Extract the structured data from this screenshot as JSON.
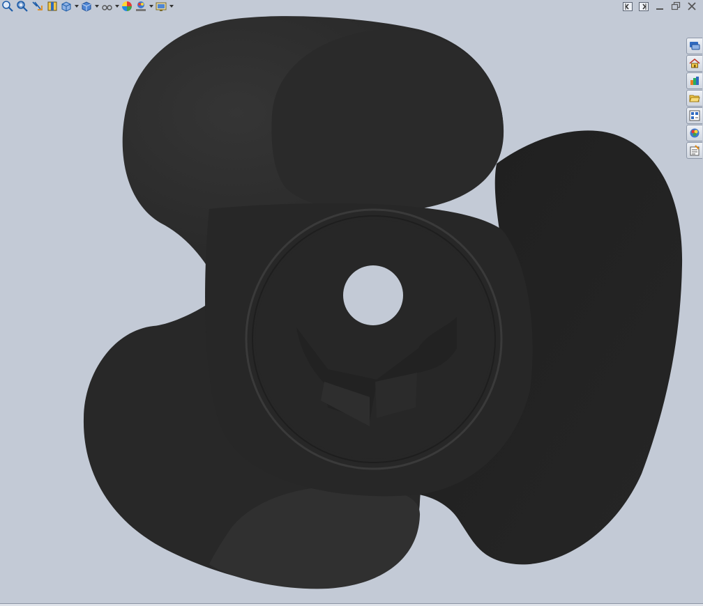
{
  "app": {
    "view": "graphics-area",
    "background_color": "#c3cad6",
    "model_color": "#272727"
  },
  "heads_up_toolbar": [
    {
      "name": "zoom-to-fit",
      "icon": "zoom-fit-icon"
    },
    {
      "name": "zoom-to-area",
      "icon": "zoom-area-icon"
    },
    {
      "name": "previous-view",
      "icon": "previous-view-icon"
    },
    {
      "name": "section-view",
      "icon": "section-view-icon"
    },
    {
      "name": "view-orientation",
      "icon": "view-orientation-icon",
      "dropdown": true
    },
    {
      "name": "display-style",
      "icon": "display-style-icon",
      "dropdown": true
    },
    {
      "name": "hide-show-items",
      "icon": "hide-show-icon",
      "dropdown": true
    },
    {
      "name": "edit-appearance",
      "icon": "appearance-icon"
    },
    {
      "name": "apply-scene",
      "icon": "scene-icon",
      "dropdown": true
    },
    {
      "name": "view-settings",
      "icon": "view-settings-icon",
      "dropdown": true
    }
  ],
  "window_controls": [
    {
      "name": "split-left",
      "icon": "split-left-icon"
    },
    {
      "name": "split-right",
      "icon": "split-right-icon"
    },
    {
      "name": "minimize",
      "icon": "minimize-icon"
    },
    {
      "name": "restore",
      "icon": "restore-icon"
    },
    {
      "name": "close",
      "icon": "close-icon"
    }
  ],
  "task_pane_tabs": [
    {
      "name": "solidworks-forum",
      "icon": "forum-icon"
    },
    {
      "name": "solidworks-resources",
      "icon": "home-icon"
    },
    {
      "name": "design-library",
      "icon": "design-library-icon"
    },
    {
      "name": "file-explorer",
      "icon": "folder-icon"
    },
    {
      "name": "view-palette",
      "icon": "view-palette-icon"
    },
    {
      "name": "appearances-scenes",
      "icon": "appearances-icon"
    },
    {
      "name": "custom-properties",
      "icon": "custom-properties-icon"
    }
  ]
}
